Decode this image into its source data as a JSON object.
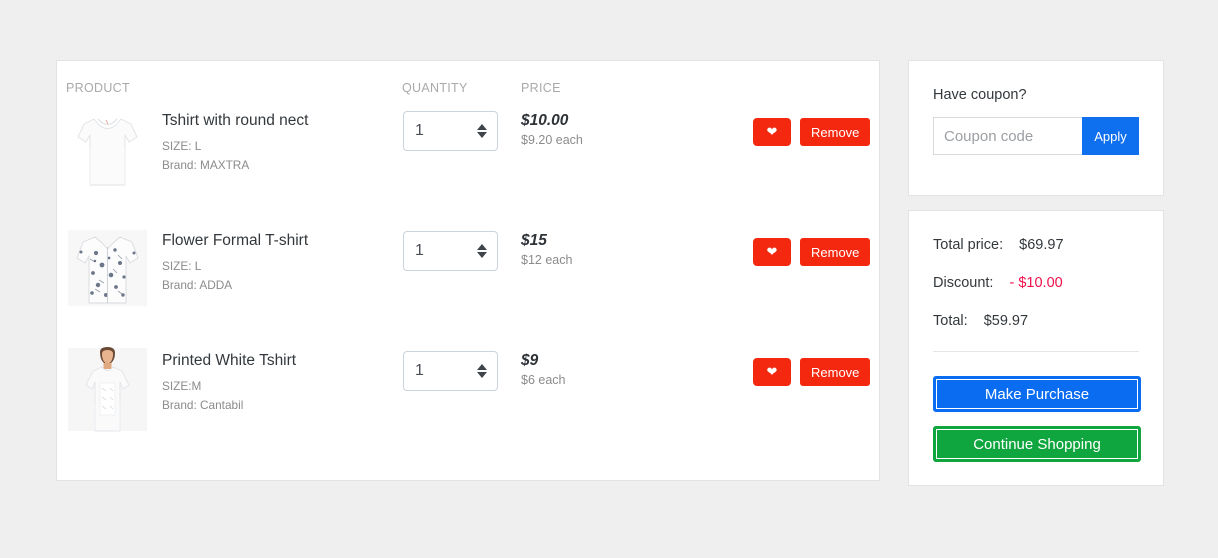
{
  "cart": {
    "headers": {
      "product": "PRODUCT",
      "quantity": "QUANTITY",
      "price": "PRICE"
    },
    "items": [
      {
        "title": "Tshirt with round nect",
        "size": "SIZE: L",
        "brand": "Brand: MAXTRA",
        "quantity": "1",
        "price": "$10.00",
        "price_each": "$9.20 each",
        "wishlist_icon": "heart-icon",
        "remove_label": "Remove",
        "image": "white-tshirt"
      },
      {
        "title": "Flower Formal T-shirt",
        "size": "SIZE: L",
        "brand": "Brand: ADDA",
        "quantity": "1",
        "price": "$15",
        "price_each": "$12 each",
        "wishlist_icon": "heart-icon",
        "remove_label": "Remove",
        "image": "floral-shirt"
      },
      {
        "title": "Printed White Tshirt",
        "size": "SIZE:M",
        "brand": "Brand: Cantabil",
        "quantity": "1",
        "price": "$9",
        "price_each": "$6 each",
        "wishlist_icon": "heart-icon",
        "remove_label": "Remove",
        "image": "model-printed-tshirt"
      }
    ]
  },
  "coupon": {
    "title": "Have coupon?",
    "placeholder": "Coupon code",
    "value": "",
    "apply_label": "Apply"
  },
  "summary": {
    "total_price_label": "Total price:",
    "total_price_value": "$69.97",
    "discount_label": "Discount:",
    "discount_value": "- $10.00",
    "total_label": "Total:",
    "total_value": "$59.97",
    "purchase_label": "Make Purchase",
    "continue_label": "Continue Shopping"
  },
  "colors": {
    "page_background": "#efefef",
    "card_background": "#ffffff",
    "accent_red": "#f4270f",
    "accent_blue": "#0e6fef",
    "accent_green": "#0fa63f",
    "discount_pink": "#f0104a",
    "header_gray": "#a9a9a9"
  }
}
